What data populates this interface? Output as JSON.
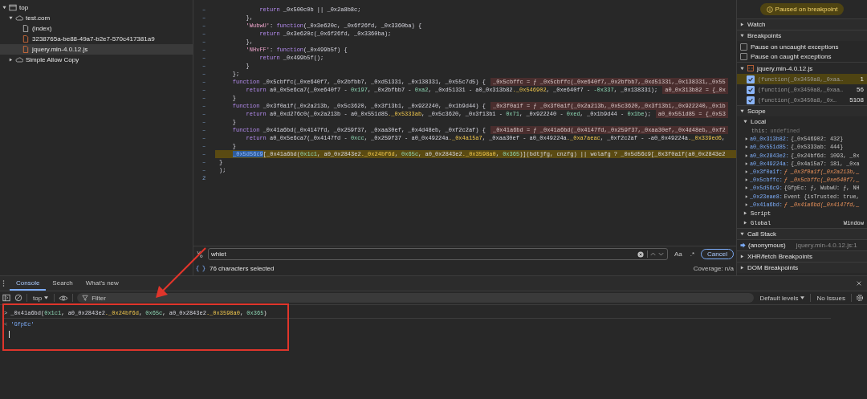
{
  "sidebar": {
    "tree": [
      {
        "label": "top",
        "kind": "frame",
        "expanded": true,
        "selected": false,
        "children": [
          {
            "label": "test.com",
            "kind": "domain",
            "expanded": true,
            "selected": false,
            "children": [
              {
                "label": "(index)",
                "kind": "document",
                "selected": false
              },
              {
                "label": "3238765a-be88-49a7-b2e7-570c417381a9",
                "kind": "script",
                "selected": false
              },
              {
                "label": "jquery.min-4.0.12.js",
                "kind": "script",
                "selected": true
              }
            ]
          },
          {
            "label": "Simple Allow Copy",
            "kind": "domain",
            "expanded": false,
            "selected": false
          }
        ]
      }
    ]
  },
  "editor": {
    "lines": [
      {
        "gutter": "–",
        "text": "            return _0x500c0b || _0x2a8b8c;",
        "paused": false
      },
      {
        "gutter": "–",
        "text": "        },",
        "paused": false
      },
      {
        "gutter": "–",
        "text": "        'WubwU': function(_0x3e620c, _0x6f26fd, _0x3360ba) {",
        "paused": false
      },
      {
        "gutter": "–",
        "text": "            return _0x3e620c(_0x6f26fd, _0x3360ba);",
        "paused": false
      },
      {
        "gutter": "–",
        "text": "        },",
        "paused": false
      },
      {
        "gutter": "–",
        "text": "        'NHvFF': function(_0x499b5f) {",
        "paused": false
      },
      {
        "gutter": "–",
        "text": "            return _0x499b5f();",
        "paused": false
      },
      {
        "gutter": "–",
        "text": "        }",
        "paused": false
      },
      {
        "gutter": "–",
        "text": "    };",
        "paused": false
      },
      {
        "gutter": "–",
        "text": "    function _0x5cbffc(_0xe640f7, _0x2bfbb7, _0xd51331, _0x138331, _0x55c7d5) {",
        "value": "_0x5cbffc = ƒ _0x5cbffc(_0xe640f7,_0x2bfbb7,_0xd51331,_0x138331,_0x55",
        "paused": false
      },
      {
        "gutter": "–",
        "text": "        return a0_0x5e6ca7(_0xe640f7 - 0x197, _0x2bfbb7 - 0xa2, _0xd51331 - a0_0x313b82._0x546902, _0xe640f7 - -0x337, _0x138331);",
        "value": "a0_0x313b82 = {_0x",
        "paused": false
      },
      {
        "gutter": "–",
        "text": "    }",
        "paused": false
      },
      {
        "gutter": "–",
        "text": "    function _0x3f0a1f(_0x2a213b, _0x5c3620, _0x3f13b1, _0x922240, _0x1b9d44) {",
        "value": "_0x3f0a1f = ƒ _0x3f0a1f(_0x2a213b,_0x5c3620,_0x3f13b1,_0x922240,_0x1b",
        "paused": false
      },
      {
        "gutter": "–",
        "text": "        return a0_0xd276c0(_0x2a213b - a0_0x551d85._0x5333ab, _0x5c3620, _0x3f13b1 - 0x71, _0x922240 - 0xed, _0x1b9d44 - 0x1be);",
        "value": "a0_0x551d85 = {_0x53",
        "paused": false
      },
      {
        "gutter": "–",
        "text": "    }",
        "paused": false
      },
      {
        "gutter": "–",
        "text": "    function _0x41a6bd(_0x4147fd, _0x259f37, _0xaa30ef, _0x4d48eb, _0xf2c2af) {",
        "value": "_0x41a6bd = ƒ _0x41a6bd(_0x4147fd,_0x259f37,_0xaa30ef,_0x4d48eb,_0xf2",
        "paused": false
      },
      {
        "gutter": "–",
        "text": "        return a0_0x5e6ca7(_0x4147fd - 0xcc, _0x259f37 - a0_0x49224a._0x4a15a7, _0xaa30ef - a0_0x49224a._0xa7aeac, _0xf2c2af - -a0_0x49224a._0x339ed6,",
        "paused": false
      },
      {
        "gutter": "–",
        "text": "    }",
        "paused": false
      },
      {
        "gutter": "–",
        "selected_text": "_0x5d56c9",
        "text": "[_0x41a6bd(0x1c1, a0_0x2843e2._0x24bf6d, 0x65c, a0_0x2843e2._0x3598a0, 0x365)](bdtjfg, cnzfg) || wolafg ? _0x5d56c9[_0x3f0a1f(a0_0x2843e2",
        "paused": true
      },
      {
        "gutter": "–",
        "text": "}",
        "paused": false
      },
      {
        "gutter": "–",
        "text": ");",
        "paused": false
      },
      {
        "gutter": "2",
        "paused": false
      }
    ],
    "search": {
      "value": "whiet",
      "match_case": "Aa",
      "regex": ".*",
      "cancel": "Cancel"
    },
    "status": {
      "selection": "76 characters selected",
      "coverage": "Coverage: n/a"
    }
  },
  "debugger": {
    "status": "Paused on breakpoint",
    "watch": {
      "title": "Watch",
      "expanded": false
    },
    "breakpoints": {
      "title": "Breakpoints",
      "expanded": true,
      "options": [
        {
          "label": "Pause on uncaught exceptions",
          "checked": false
        },
        {
          "label": "Pause on caught exceptions",
          "checked": false
        }
      ],
      "file": "jquery.min-4.0.12.js",
      "items": [
        {
          "text": "(function(_0x3450a8,_0xaa…",
          "line": "1",
          "checked": true,
          "selected": true
        },
        {
          "text": "(function(_0x3450a8,_0xaa…",
          "line": "56",
          "checked": true,
          "selected": false
        },
        {
          "text": "(function(_0x3450a8,_0x…",
          "line": "5108",
          "checked": true,
          "selected": false
        }
      ]
    },
    "scope": {
      "title": "Scope",
      "expanded": true,
      "local": {
        "title": "Local",
        "expanded": true,
        "this_name": "this:",
        "this_value": "undefined",
        "variables": [
          {
            "name": "a0_0x313b82:",
            "kind": "object",
            "value": "{_0x546902: 432}"
          },
          {
            "name": "a0_0x551d85:",
            "kind": "object",
            "value": "{_0x5333ab: 444}"
          },
          {
            "name": "a0_0x2843e2:",
            "kind": "object",
            "value": "{_0x24bf6d: 1093, _0x"
          },
          {
            "name": "a0_0x49224a:",
            "kind": "object",
            "value": "{_0x4a15a7: 181, _0xa"
          },
          {
            "name": "_0x3f0a1f:",
            "kind": "function",
            "value": "ƒ _0x3f0a1f(_0x2a213b,_"
          },
          {
            "name": "_0x5cbffc:",
            "kind": "function",
            "value": "ƒ _0x5cbffc(_0xe640f7,_"
          },
          {
            "name": "_0x5d56c9:",
            "kind": "object",
            "value": "{GfpEc: ƒ, WubwU: ƒ, NH"
          },
          {
            "name": "_0x23eae8:",
            "kind": "object",
            "value": "Event {isTrusted: true,"
          },
          {
            "name": "_0x41a6bd:",
            "kind": "function",
            "value": "ƒ _0x41a6bd(_0x4147fd,_"
          }
        ]
      },
      "groups": [
        {
          "title": "Script",
          "expanded": false
        },
        {
          "title": "Global",
          "value": "Window",
          "expanded": false
        }
      ]
    },
    "call_stack": {
      "title": "Call Stack",
      "expanded": true,
      "frames": [
        {
          "name": "(anonymous)",
          "location": "jquery.min-4.0.12.js:1",
          "selected": true
        }
      ]
    },
    "more": [
      {
        "title": "XHR/fetch Breakpoints",
        "expanded": false
      },
      {
        "title": "DOM Breakpoints",
        "expanded": false
      }
    ]
  },
  "drawer": {
    "tabs": [
      {
        "label": "Console",
        "selected": true
      },
      {
        "label": "Search",
        "selected": false
      },
      {
        "label": "What's new",
        "selected": false
      }
    ],
    "toolbar": {
      "context": "top",
      "filter_placeholder": "Filter",
      "levels": "Default levels",
      "issues": "No Issues"
    },
    "entries": [
      {
        "kind": "input",
        "prompt": ">",
        "text": "_0x41a6bd(0x1c1, a0_0x2843e2._0x24bf6d, 0x65c, a0_0x2843e2._0x3598a0, 0x365)"
      },
      {
        "kind": "result",
        "prompt": "<",
        "text": "'GfpEc'"
      }
    ],
    "cursor": true
  },
  "annotations": {
    "arrow": true,
    "frame": true
  }
}
